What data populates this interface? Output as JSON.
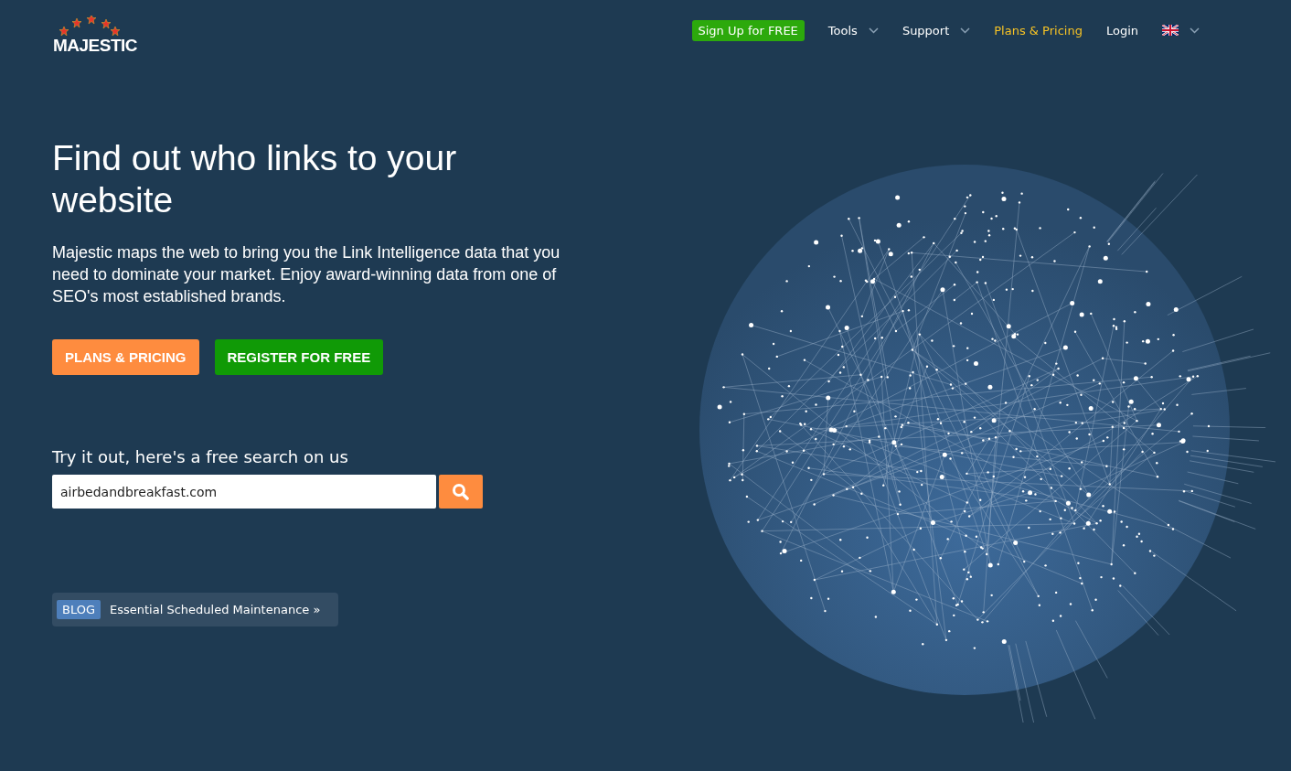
{
  "logo": {
    "text": "MAJESTIC"
  },
  "nav": [
    {
      "kind": "cta",
      "label": "Sign Up for FREE"
    },
    {
      "kind": "dropdown",
      "label": "Tools"
    },
    {
      "kind": "dropdown",
      "label": "Support"
    },
    {
      "kind": "highlight",
      "label": "Plans & Pricing"
    },
    {
      "kind": "link",
      "label": "Login"
    },
    {
      "kind": "language"
    }
  ],
  "hero": {
    "title": "Find out who links to your website",
    "description": "Majestic maps the web to bring you the Link Intelligence data that you need to dominate your market. Enjoy award-winning data from one of SEO's most established brands.",
    "buttons": [
      {
        "kind": "orange",
        "label": "PLANS & PRICING"
      },
      {
        "kind": "green",
        "label": "REGISTER FOR FREE"
      }
    ]
  },
  "search": {
    "heading": "Try it out, here's a free search on us",
    "value": "airbedandbreakfast.com"
  },
  "blog": {
    "tag": "BLOG",
    "link": "Essential Scheduled Maintenance »"
  }
}
